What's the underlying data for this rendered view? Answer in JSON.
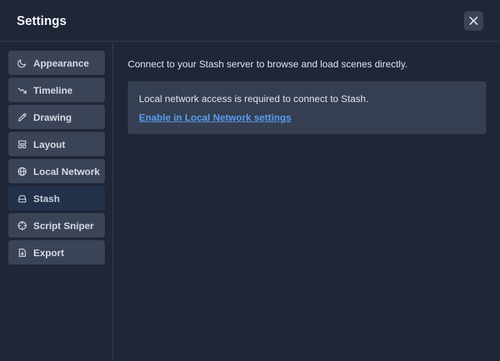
{
  "dialog": {
    "title": "Settings",
    "close_icon": "close-icon"
  },
  "sidebar": {
    "active": "Stash",
    "items": [
      {
        "label": "Appearance",
        "icon": "moon-icon"
      },
      {
        "label": "Timeline",
        "icon": "trend-arrow-icon"
      },
      {
        "label": "Drawing",
        "icon": "pencil-icon"
      },
      {
        "label": "Layout",
        "icon": "layout-icon"
      },
      {
        "label": "Local Network",
        "icon": "globe-icon"
      },
      {
        "label": "Stash",
        "icon": "drawer-icon"
      },
      {
        "label": "Script Sniper",
        "icon": "crosshair-icon"
      },
      {
        "label": "Export",
        "icon": "file-export-icon"
      }
    ]
  },
  "main": {
    "intro": "Connect to your Stash server to browse and load scenes directly.",
    "notice": {
      "text": "Local network access is required to connect to Stash.",
      "link": "Enable in Local Network settings"
    }
  },
  "colors": {
    "background": "#1f2737",
    "nav_item": "#3a4456",
    "nav_item_active": "#23324a",
    "notice_bg": "#353f51",
    "link": "#5a9df0"
  }
}
